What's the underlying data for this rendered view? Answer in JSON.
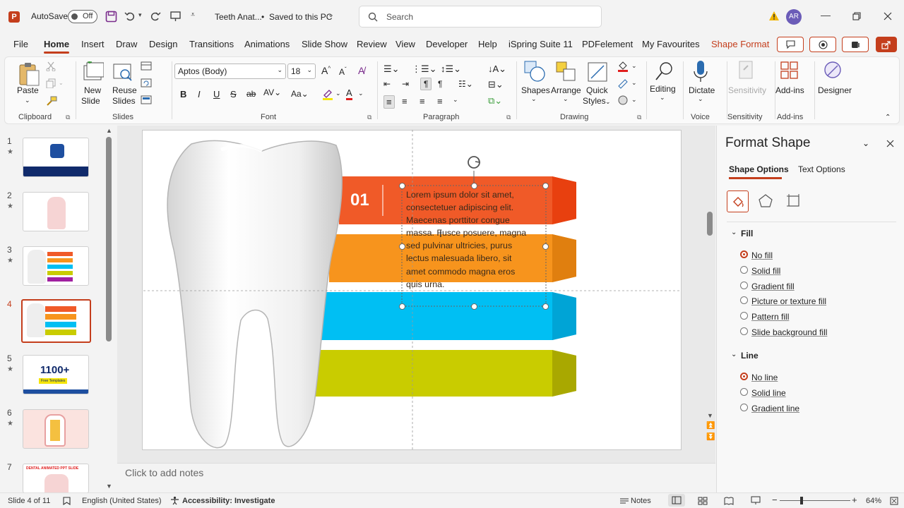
{
  "titlebar": {
    "app_initial": "P",
    "autosave_label": "AutoSave",
    "autosave_state": "Off",
    "doc_title": "Teeth Anat...",
    "save_status": "Saved to this PC",
    "search_placeholder": "Search",
    "user_initials": "AR"
  },
  "menu": {
    "tabs": [
      "File",
      "Home",
      "Insert",
      "Draw",
      "Design",
      "Transitions",
      "Animations",
      "Slide Show",
      "Review",
      "View",
      "Developer",
      "Help",
      "iSpring Suite 11",
      "PDFelement",
      "My Favourites",
      "Shape Format"
    ],
    "active_tab": "Home"
  },
  "ribbon": {
    "clipboard": {
      "paste": "Paste",
      "group": "Clipboard"
    },
    "slides": {
      "new_slide": "New",
      "new_slide2": "Slide",
      "reuse": "Reuse",
      "reuse2": "Slides",
      "group": "Slides"
    },
    "font": {
      "family": "Aptos (Body)",
      "size": "18",
      "group": "Font"
    },
    "paragraph": {
      "group": "Paragraph"
    },
    "drawing": {
      "shapes": "Shapes",
      "arrange": "Arrange",
      "quick": "Quick",
      "styles": "Styles",
      "group": "Drawing"
    },
    "editing": {
      "label": "Editing"
    },
    "voice": {
      "dictate": "Dictate",
      "group": "Voice"
    },
    "sensitivity": {
      "label": "Sensitivity",
      "group": "Sensitivity"
    },
    "addins": {
      "label": "Add-ins",
      "group": "Add-ins"
    },
    "designer": {
      "label": "Designer"
    }
  },
  "thumbnails": {
    "numbers": [
      "1",
      "2",
      "3",
      "4",
      "5",
      "6",
      "7"
    ],
    "selected": "4",
    "slide5_text": "1100+",
    "slide5_sub": "Free Templates",
    "slide7_text": "DENTAL ANIMATED PPT SLIDE"
  },
  "slide": {
    "number_label": "01",
    "body_text": "Lorem ipsum dolor sit amet,\nconsectetuer adipiscing elit.\nMaecenas porttitor congue\nmassa. Fusce posuere, magna\nsed pulvinar ultricies, purus\nlectus malesuada libero, sit\namet commodo magna eros\nquis urna.",
    "band_colors": [
      "#f05a28",
      "#f7941d",
      "#00bff3",
      "#c9cc00"
    ]
  },
  "notes": {
    "placeholder": "Click to add notes"
  },
  "format_pane": {
    "title": "Format Shape",
    "tab_shape": "Shape Options",
    "tab_text": "Text Options",
    "fill_header": "Fill",
    "fill_options": [
      "No fill",
      "Solid fill",
      "Gradient fill",
      "Picture or texture fill",
      "Pattern fill",
      "Slide background fill"
    ],
    "fill_selected": "No fill",
    "line_header": "Line",
    "line_options": [
      "No line",
      "Solid line",
      "Gradient line"
    ],
    "line_selected": "No line"
  },
  "statusbar": {
    "slide_of": "Slide 4 of 11",
    "language": "English (United States)",
    "accessibility": "Accessibility: Investigate",
    "notes": "Notes",
    "zoom": "64%"
  },
  "colors": {
    "accent": "#c43e1c"
  }
}
